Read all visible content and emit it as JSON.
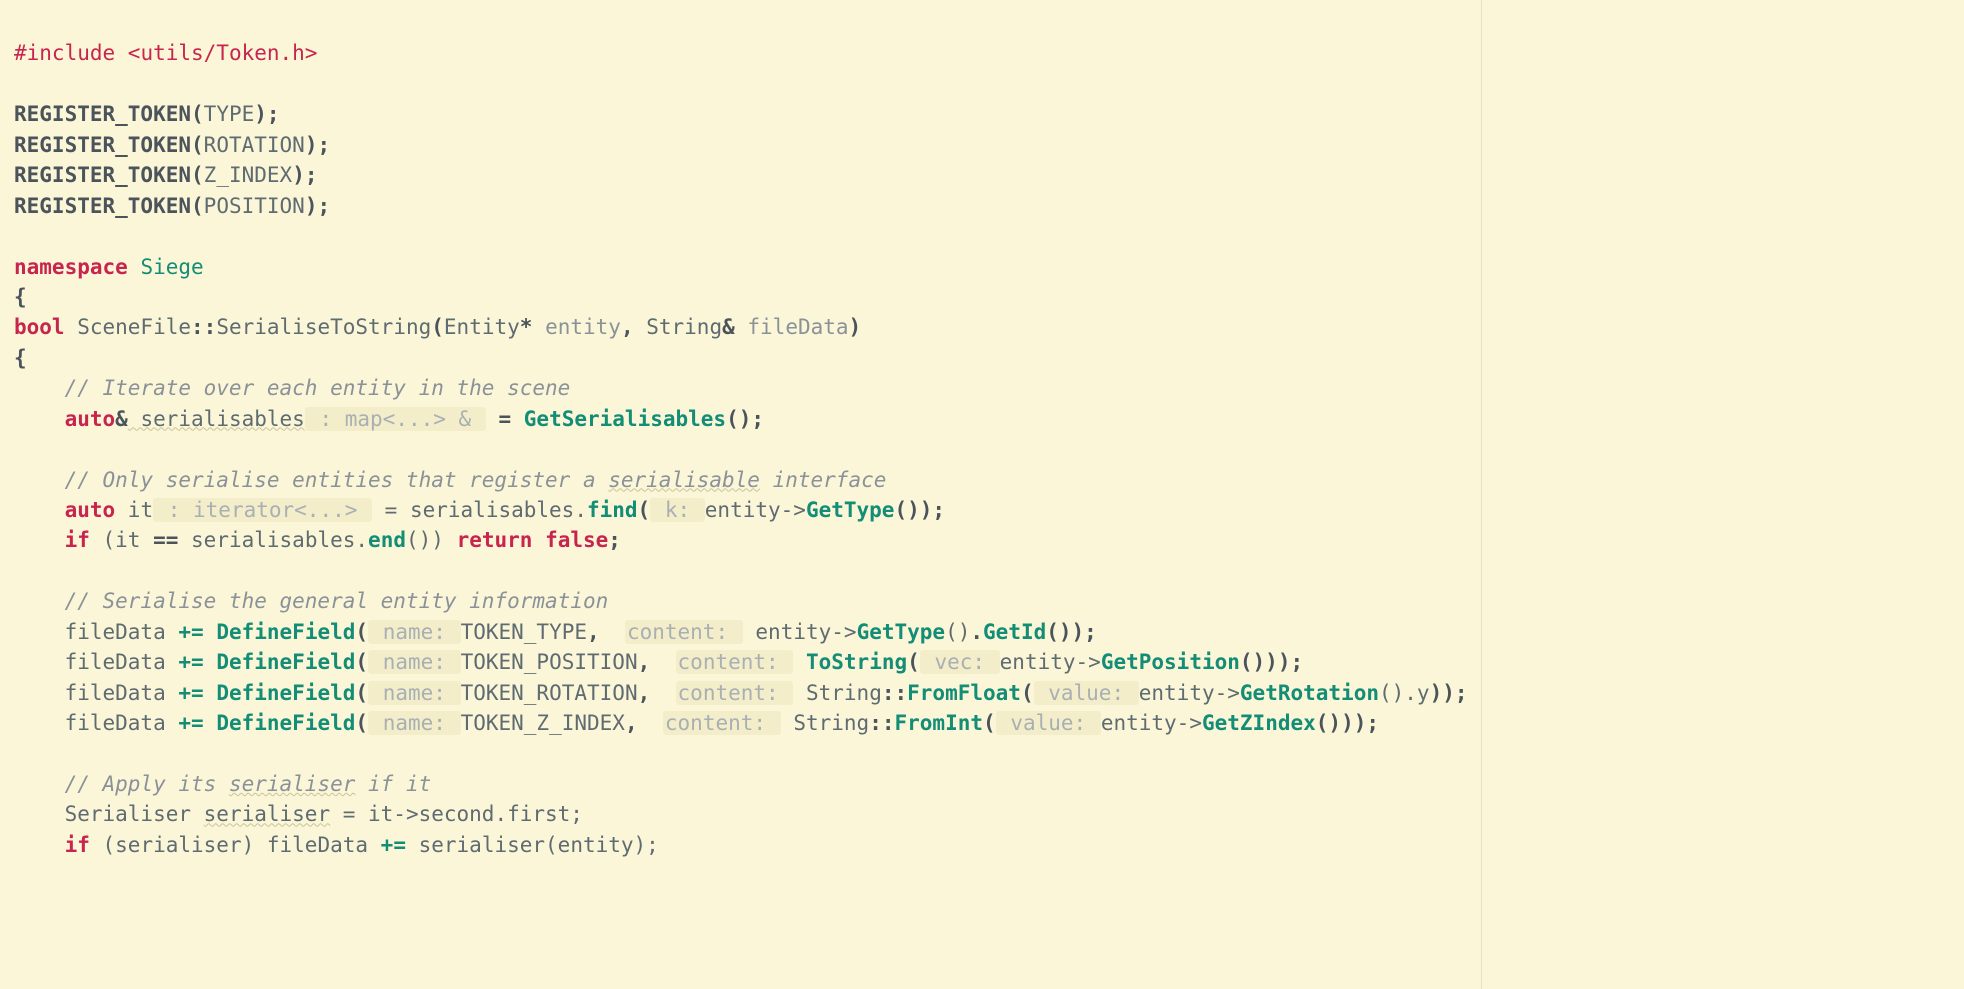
{
  "lines": {
    "l1": {
      "pre": "#include",
      "path": " <utils/Token.h>"
    },
    "l2": "",
    "reg": {
      "macro": "REGISTER_TOKEN",
      "a": "TYPE",
      "b": "ROTATION",
      "c": "Z_INDEX",
      "d": "POSITION"
    },
    "ns": {
      "kw": "namespace",
      "name": " Siege"
    },
    "brace_open": "{",
    "brace_close": "}",
    "sig": {
      "bool": "bool",
      "class": " SceneFile",
      "coloncolon": "::",
      "fn": "SerialiseToString",
      "open": "(",
      "t_entity": "Entity",
      "star": "*",
      "p_entity": " entity",
      "comma": ", ",
      "t_string": "String",
      "amp": "&",
      "p_fileData": " fileData",
      "close": ")"
    },
    "c1": "    // Iterate over each entity in the scene",
    "ser": {
      "auto": "    auto",
      "amp": "&",
      "var": " serialisables",
      "hint": " : map<...> & ",
      "eq": " = ",
      "fn": "GetSerialisables",
      "call": "();"
    },
    "c2": "    // Only serialise entities that register a ",
    "c2b": "serialisable",
    "c2c": " interface",
    "it": {
      "auto": "    auto",
      "var": " it",
      "hint": " : iterator<...> ",
      "eq": " = serialisables.",
      "fn": "find",
      "open": "(",
      "phint": " k: ",
      "expr1": "entity->",
      "gettype": "GetType",
      "close": "());"
    },
    "ifend": {
      "pre": "    ",
      "if": "if",
      "cond1": " (it ",
      "eqeq": "==",
      "cond2": " serialisables.",
      "end": "end",
      "cond3": "()) ",
      "ret": "return",
      "sp": " ",
      "false": "false",
      "semi": ";"
    },
    "c3": "    // Serialise the general entity information",
    "df": {
      "pre": "    fileData ",
      "op": "+=",
      "sp": " ",
      "fn": "DefineField",
      "open": "(",
      "h_name": " name: ",
      "h_content": "content: ",
      "T_TYPE": "TOKEN_TYPE",
      "T_POS": "TOKEN_POSITION",
      "T_ROT": "TOKEN_ROTATION",
      "T_Z": "TOKEN_Z_INDEX",
      "comma": ",  ",
      "ent_arrow": "entity->",
      "GetType": "GetType",
      "GetId": "GetId",
      "ToString": "ToString",
      "h_vec": " vec: ",
      "GetPosition": "GetPosition",
      "String": "String",
      "coloncolon": "::",
      "FromFloat": "FromFloat",
      "h_value": " value: ",
      "GetRotation": "GetRotation",
      "doty": ".y",
      "FromInt": "FromInt",
      "GetZIndex": "GetZIndex",
      "dot": ".",
      "closeP": "()",
      "closeAll": "());",
      "closeAll2": "()));",
      "closeAll3": "));"
    },
    "c4a": "    // Apply its ",
    "c4b": "serialiser",
    "c4c": " if it",
    "serline": {
      "type": "    Serialiser ",
      "var": "serialiser",
      "rhs": " = it->second.first;"
    },
    "ifser": {
      "pre": "    ",
      "if": "if",
      "cond": " (serialiser) fileData ",
      "op": "+=",
      "rhs": " serialiser(entity);"
    }
  }
}
